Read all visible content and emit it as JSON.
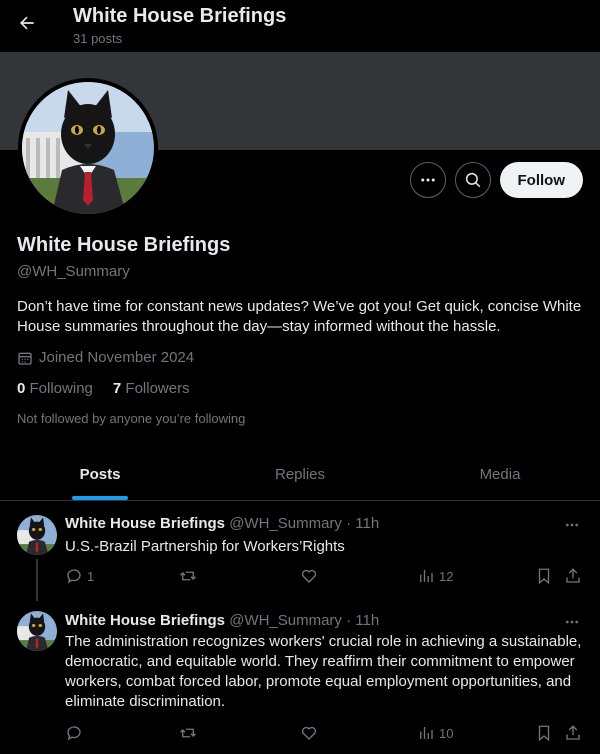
{
  "header": {
    "title": "White House Briefings",
    "post_count": "31 posts"
  },
  "profile": {
    "name": "White House Briefings",
    "handle": "@WH_Summary",
    "bio": "Don’t have time for constant news updates? We’ve got you! Get quick, concise White House summaries throughout the day—stay informed without the hassle.",
    "joined": "Joined November 2024",
    "following_count": "0",
    "following_label": "Following",
    "followers_count": "7",
    "followers_label": "Followers",
    "followed_by_note": "Not followed by anyone you’re following",
    "follow_label": "Follow"
  },
  "tabs": [
    {
      "label": "Posts",
      "active": true
    },
    {
      "label": "Replies",
      "active": false
    },
    {
      "label": "Media",
      "active": false
    }
  ],
  "posts": [
    {
      "name": "White House Briefings",
      "meta": "@WH_Summary · 11h",
      "text": "U.S.-Brazil Partnership for Workers’Rights",
      "replies": "1",
      "views": "12"
    },
    {
      "name": "White House Briefings",
      "meta": "@WH_Summary · 11h",
      "text": "The administration recognizes workers' crucial role in achieving a sustainable, democratic, and equitable world. They reaffirm their commitment to empower workers, combat forced labor, promote equal employment opportunities, and eliminate discrimination.",
      "replies": "",
      "views": "10"
    }
  ],
  "colors": {
    "background": "#000000",
    "text": "#e7e9ea",
    "muted": "#71767b",
    "accent": "#1d9bf0",
    "banner": "#333639"
  },
  "icons": {
    "back": "arrow-left-icon",
    "more": "more-horizontal-icon",
    "search": "search-icon",
    "calendar": "calendar-icon",
    "reply": "reply-icon",
    "repost": "repost-icon",
    "like": "heart-icon",
    "views": "views-icon",
    "bookmark": "bookmark-icon",
    "share": "share-icon"
  }
}
